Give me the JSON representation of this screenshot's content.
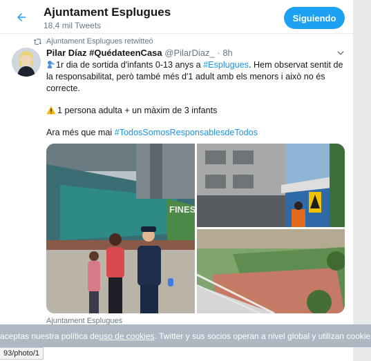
{
  "header": {
    "back_icon": "arrow-left-icon",
    "account_name": "Ajuntament Esplugues",
    "tweet_count": "18,4 mil Tweets",
    "follow_label": "Siguiendo"
  },
  "tweet": {
    "retweet_note": "Ajuntament Esplugues retwitteó",
    "author_name": "Pilar Díaz #QuédateenCasa",
    "author_handle": "@PilarDiaz_",
    "dot": "·",
    "time": "8h",
    "line1_pre": "1r dia de sortida d'infants 0-13 anys a ",
    "line1_tag": "#Esplugues",
    "line1_post": ". Hem observat sentit de la responsabilitat, però també més d'1 adult amb els menors i això no és correcte.",
    "line2": "1 persona adulta + un màxim de 3 infants",
    "line3_pre": "Ara més que mai ",
    "line3_tag": "#TodosSomosResponsablesdeTodos",
    "photo_sign_text": "FINES"
  },
  "footer": {
    "source": "Ajuntament Esplugues"
  },
  "cookie_bar": {
    "text_pre": "aceptas nuestra política de ",
    "link": "uso de cookies",
    "text_post": ". Twitter y sus socios operan a nivel global y utilizan cookies para aná"
  },
  "status_url": "93/photo/1",
  "colors": {
    "accent": "#1da1f2",
    "link": "#1b95e0",
    "secondary_text": "#657786"
  }
}
